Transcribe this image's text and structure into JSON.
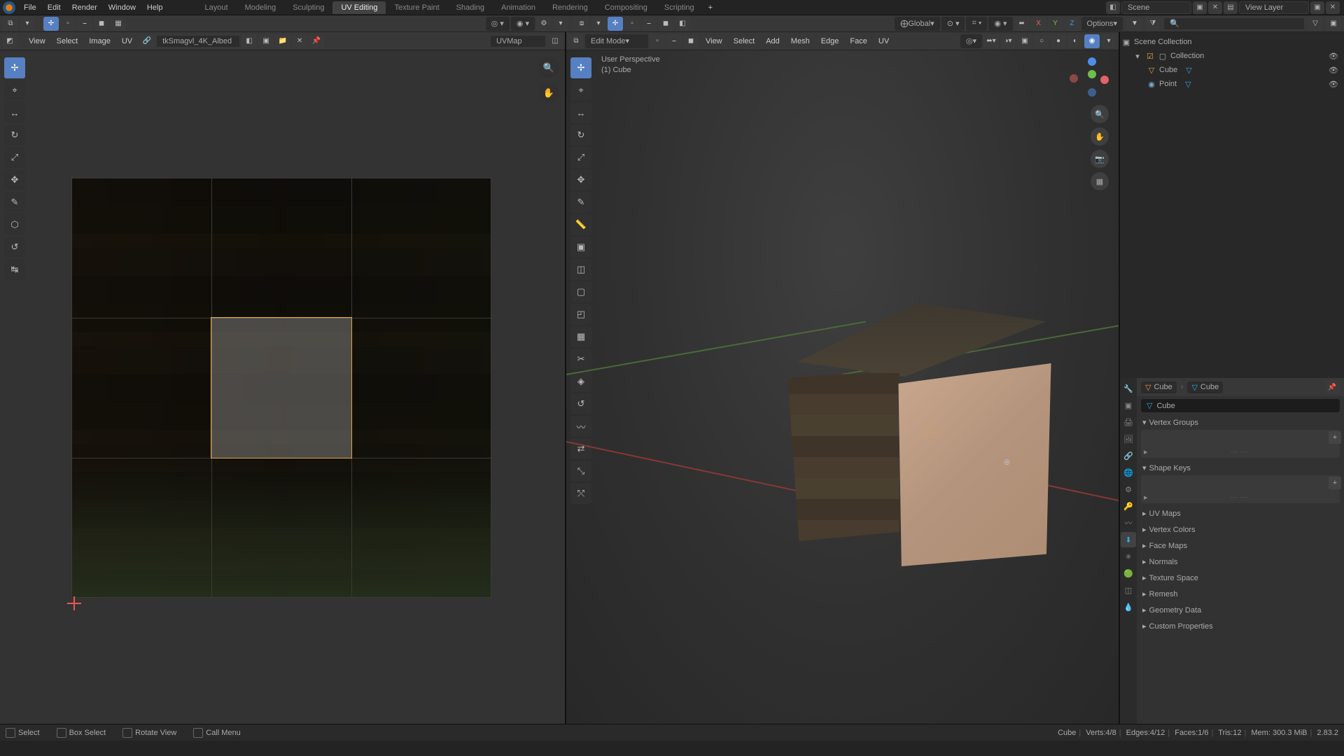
{
  "main_menu": [
    "File",
    "Edit",
    "Render",
    "Window",
    "Help"
  ],
  "workspace_tabs": [
    "Layout",
    "Modeling",
    "Sculpting",
    "UV Editing",
    "Texture Paint",
    "Shading",
    "Animation",
    "Rendering",
    "Compositing",
    "Scripting"
  ],
  "active_tab": "UV Editing",
  "scene_name": "Scene",
  "view_layer": "View Layer",
  "uv_header": {
    "menus": [
      "View",
      "Select",
      "Image",
      "UV"
    ],
    "image_name": "tkSmagvl_4K_Albed",
    "uvmap_name": "UVMap"
  },
  "viewport_header": {
    "mode": "Edit Mode",
    "menus": [
      "View",
      "Select",
      "Add",
      "Mesh",
      "Edge",
      "Face",
      "UV"
    ],
    "orientation": "Global",
    "options_label": "Options"
  },
  "vp_info": {
    "line1": "User Perspective",
    "line2": "(1) Cube"
  },
  "outliner": {
    "root": "Scene Collection",
    "collection": "Collection",
    "objects": [
      "Cube",
      "Point"
    ]
  },
  "properties": {
    "breadcrumb": [
      "Cube",
      "Cube"
    ],
    "name": "Cube",
    "sections_open": [
      "Vertex Groups",
      "Shape Keys"
    ],
    "sections_closed": [
      "UV Maps",
      "Vertex Colors",
      "Face Maps",
      "Normals",
      "Texture Space",
      "Remesh",
      "Geometry Data",
      "Custom Properties"
    ]
  },
  "status": {
    "left": [
      {
        "icon": "mouse",
        "label": "Select"
      },
      {
        "icon": "mouse",
        "label": "Box Select"
      },
      {
        "icon": "mouse",
        "label": "Rotate View"
      },
      {
        "icon": "menu",
        "label": "Call Menu"
      }
    ],
    "right": {
      "object": "Cube",
      "verts": "Verts:4/8",
      "edges": "Edges:4/12",
      "faces": "Faces:1/6",
      "tris": "Tris:12",
      "mem": "Mem: 300.3 MiB",
      "ver": "2.83.2"
    }
  },
  "colors": {
    "accent": "#5680c2",
    "x": "#e36366",
    "y": "#6cbf4b",
    "z": "#4e8de8"
  }
}
